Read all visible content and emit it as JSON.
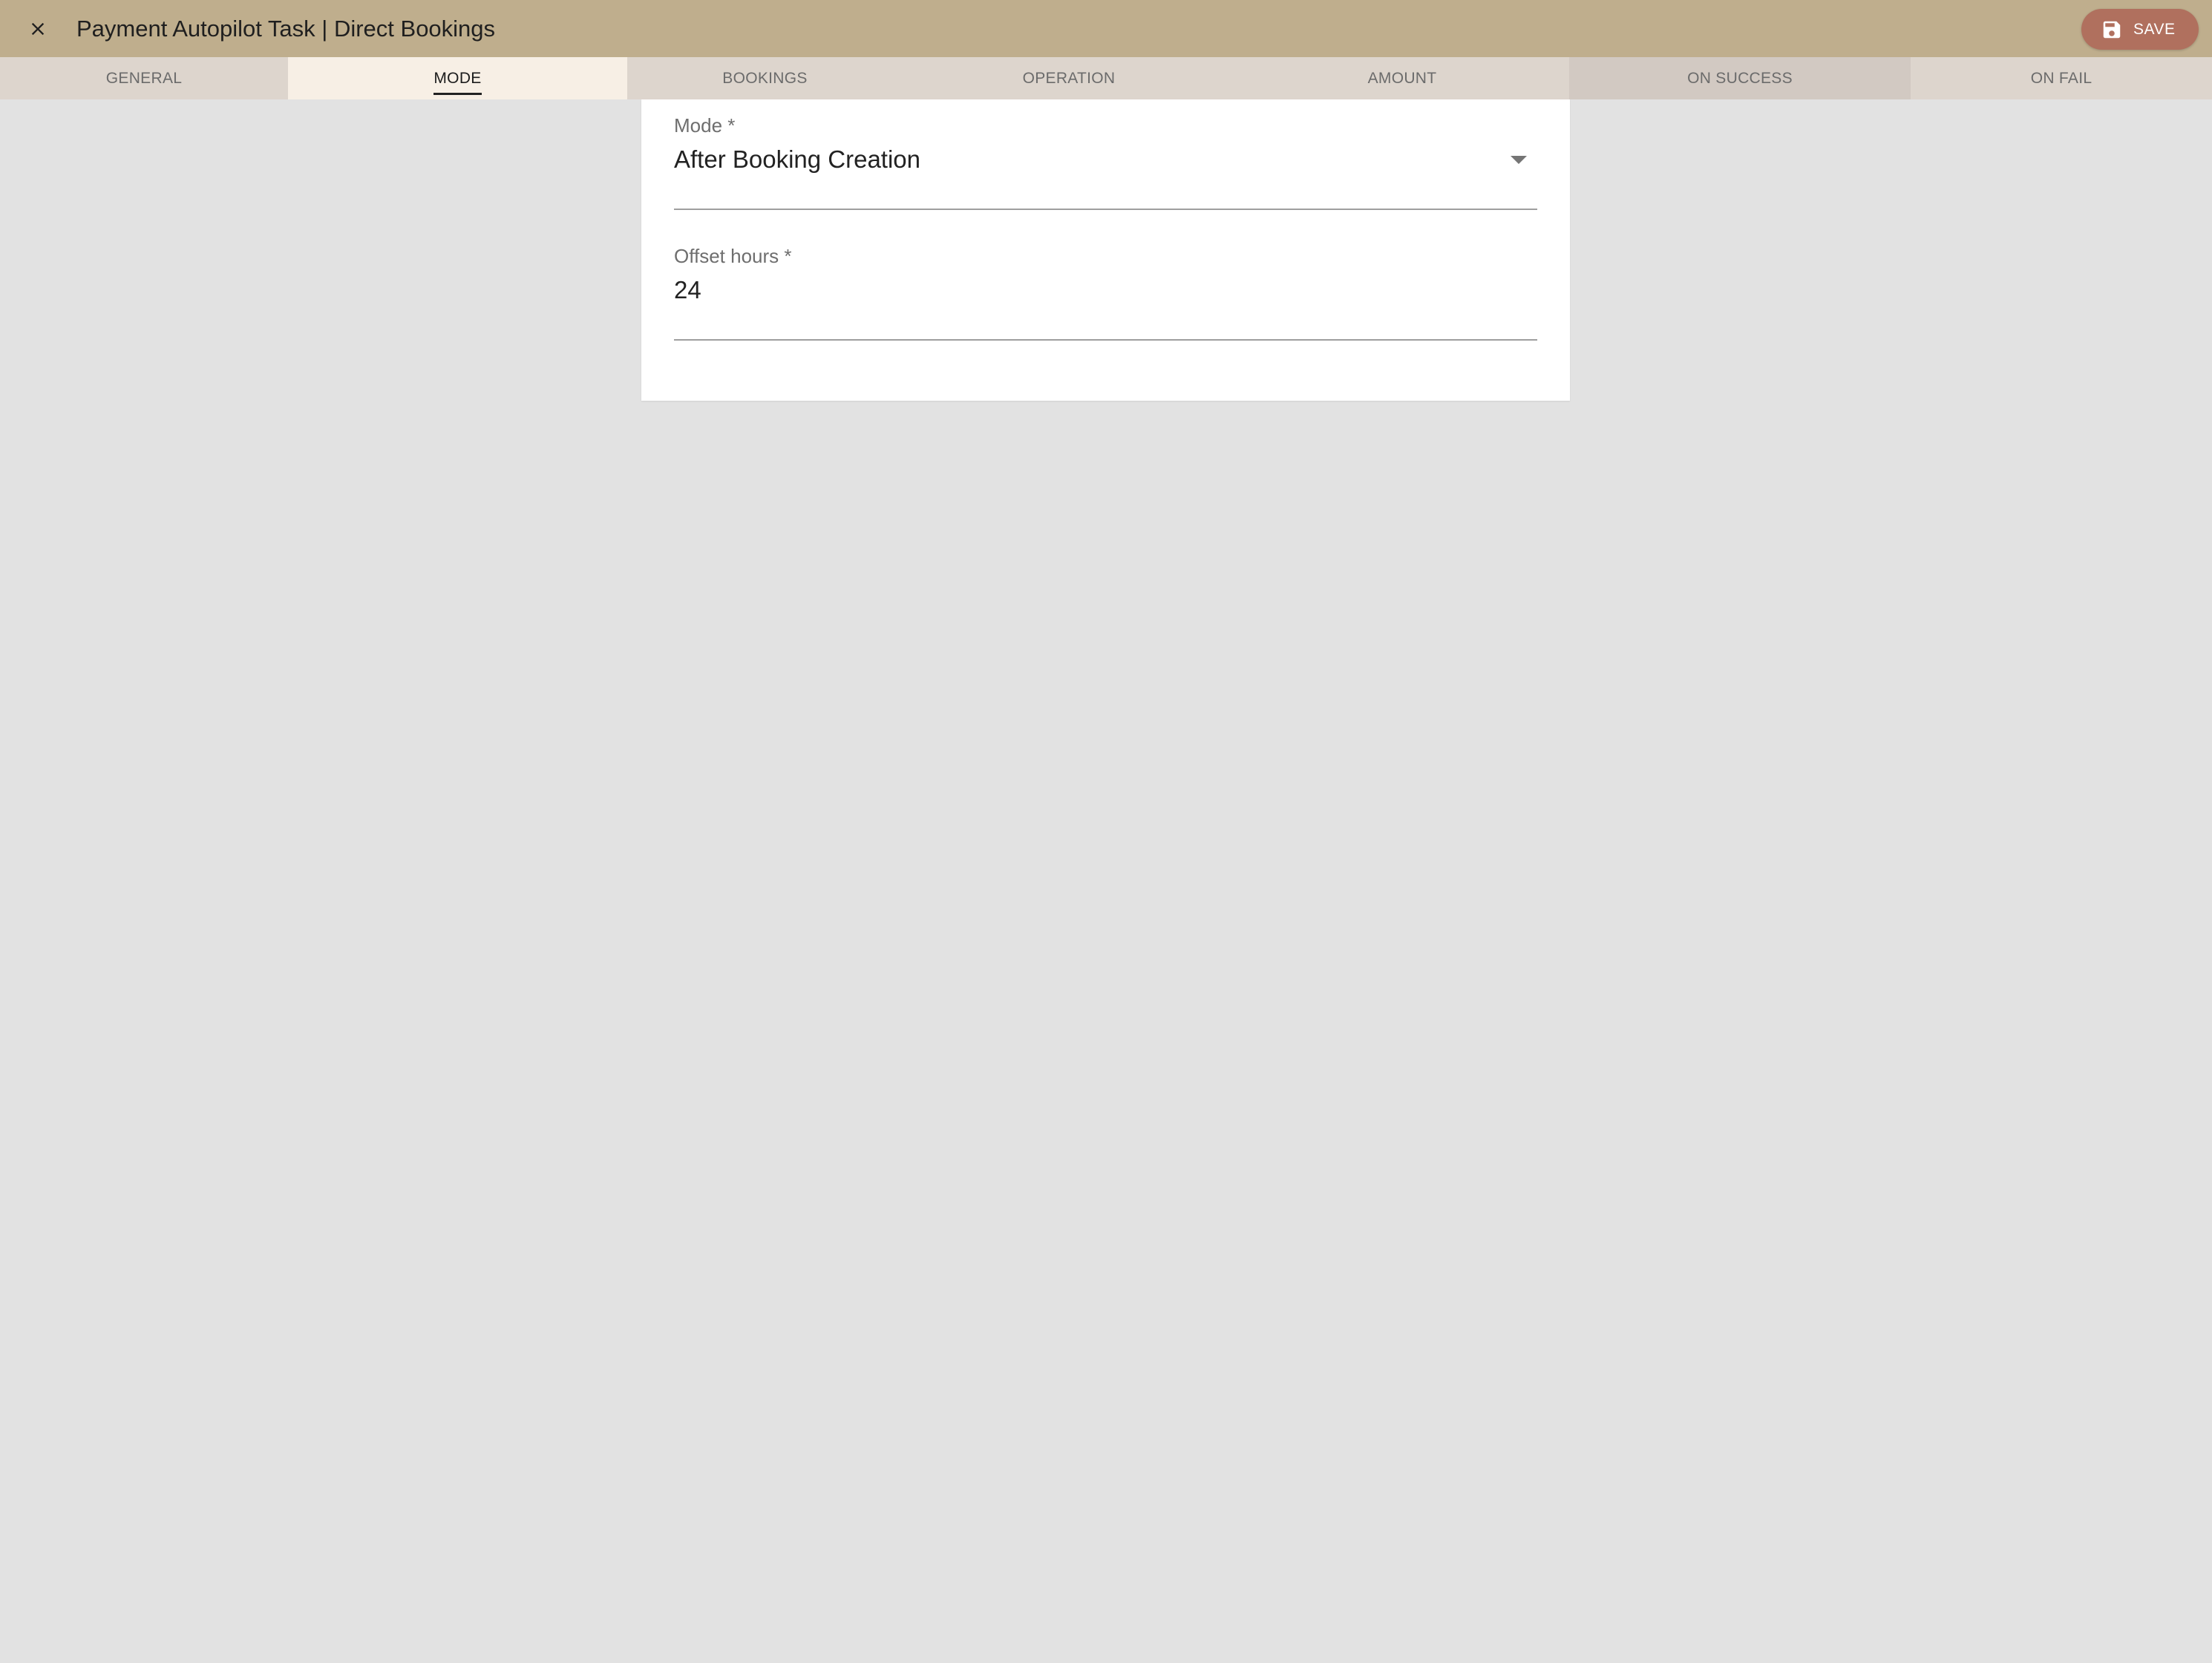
{
  "header": {
    "title": "Payment Autopilot Task | Direct Bookings",
    "save_label": "SAVE",
    "background_color": "#bfae8d",
    "save_button_color": "#b0705e"
  },
  "tabs": [
    {
      "label": "GENERAL",
      "active": false
    },
    {
      "label": "MODE",
      "active": true
    },
    {
      "label": "BOOKINGS",
      "active": false
    },
    {
      "label": "OPERATION",
      "active": false
    },
    {
      "label": "AMOUNT",
      "active": false
    },
    {
      "label": "ON SUCCESS",
      "active": false
    },
    {
      "label": "ON FAIL",
      "active": false
    }
  ],
  "form": {
    "mode": {
      "label": "Mode *",
      "value": "After Booking Creation"
    },
    "offset_hours": {
      "label": "Offset hours *",
      "value": "24"
    }
  },
  "icons": {
    "close": "close-icon",
    "save": "save-icon",
    "dropdown": "arrow-drop-down-icon"
  }
}
